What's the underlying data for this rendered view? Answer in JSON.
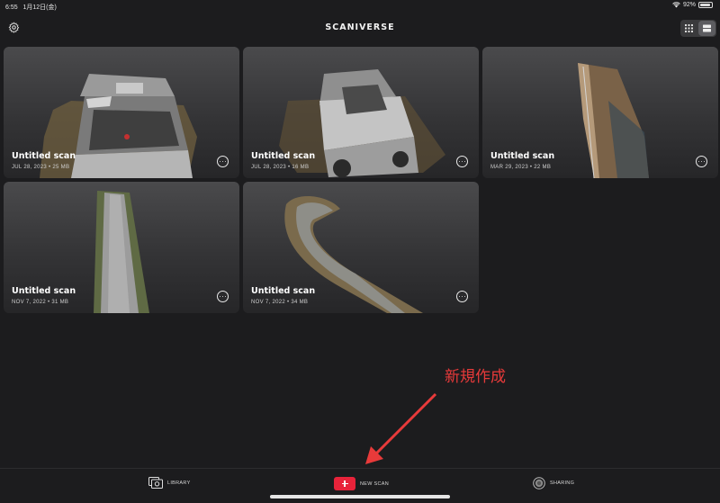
{
  "status": {
    "time": "6:55",
    "date": "1月12日(金)",
    "battery": "92%"
  },
  "header": {
    "title": "SCANIVERSE"
  },
  "scans": [
    {
      "name": "Untitled scan",
      "meta": "JUL 28, 2023 • 25 MB"
    },
    {
      "name": "Untitled scan",
      "meta": "JUL 28, 2023 • 16 MB"
    },
    {
      "name": "Untitled scan",
      "meta": "MAR 29, 2023 • 22 MB"
    },
    {
      "name": "Untitled scan",
      "meta": "NOV 7, 2022 • 31 MB"
    },
    {
      "name": "Untitled scan",
      "meta": "NOV 7, 2022 • 34 MB"
    }
  ],
  "annotation": {
    "text": "新規作成",
    "color": "#e83a3a"
  },
  "tabbar": {
    "library": "LIBRARY",
    "new_scan": "NEW SCAN",
    "sharing": "SHARING"
  },
  "colors": {
    "accent": "#e8233a",
    "background": "#1c1c1e"
  },
  "icons": [
    "settings-gear-icon",
    "grid-view-icon",
    "list-view-icon",
    "more-options-icon",
    "library-icon",
    "plus-icon",
    "sharing-icon"
  ]
}
